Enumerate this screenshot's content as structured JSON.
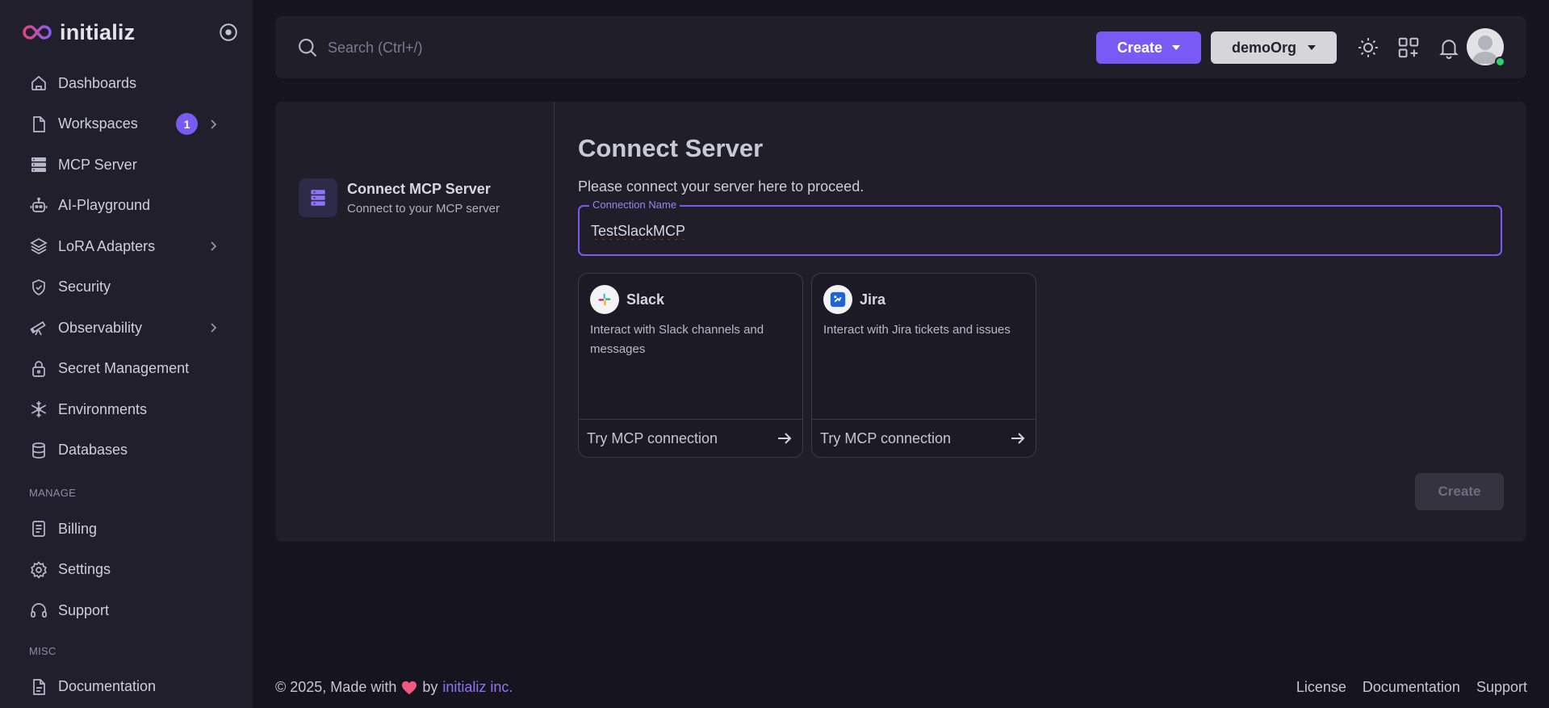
{
  "brand": {
    "name": "initializ",
    "accent": "#7a5af5"
  },
  "sidebar": {
    "items": [
      {
        "label": "Dashboards",
        "icon": "home-icon"
      },
      {
        "label": "Workspaces",
        "icon": "file-icon",
        "badge": "1",
        "chevron": true
      },
      {
        "label": "MCP Server",
        "icon": "server-icon"
      },
      {
        "label": "AI-Playground",
        "icon": "robot-icon"
      },
      {
        "label": "LoRA Adapters",
        "icon": "layers-icon",
        "chevron": true
      },
      {
        "label": "Security",
        "icon": "shield-icon"
      },
      {
        "label": "Observability",
        "icon": "telescope-icon",
        "chevron": true
      },
      {
        "label": "Secret Management",
        "icon": "lock-icon"
      },
      {
        "label": "Environments",
        "icon": "snowflake-icon"
      },
      {
        "label": "Databases",
        "icon": "database-icon"
      }
    ],
    "manage_title": "MANAGE",
    "manage_items": [
      {
        "label": "Billing",
        "icon": "receipt-icon"
      },
      {
        "label": "Settings",
        "icon": "gear-icon"
      },
      {
        "label": "Support",
        "icon": "headphones-icon"
      }
    ],
    "misc_title": "MISC",
    "misc_items": [
      {
        "label": "Documentation",
        "icon": "document-icon"
      }
    ]
  },
  "topbar": {
    "search_placeholder": "Search (Ctrl+/)",
    "create_label": "Create",
    "org_label": "demoOrg"
  },
  "stepper": {
    "title": "Connect MCP Server",
    "subtitle": "Connect to your MCP server"
  },
  "form": {
    "title": "Connect Server",
    "subtitle": "Please connect your server here to proceed.",
    "connection_label": "Connection Name",
    "connection_value": "TestSlackMCP",
    "create_label": "Create"
  },
  "integrations": [
    {
      "name": "Slack",
      "description": "Interact with Slack channels and messages",
      "action": "Try MCP connection",
      "icon": "slack-icon"
    },
    {
      "name": "Jira",
      "description": "Interact with Jira tickets and issues",
      "action": "Try MCP connection",
      "icon": "jira-icon"
    }
  ],
  "footer": {
    "copyright": "© 2025, Made with",
    "by": "by",
    "company": "initializ inc.",
    "links": [
      "License",
      "Documentation",
      "Support"
    ]
  }
}
